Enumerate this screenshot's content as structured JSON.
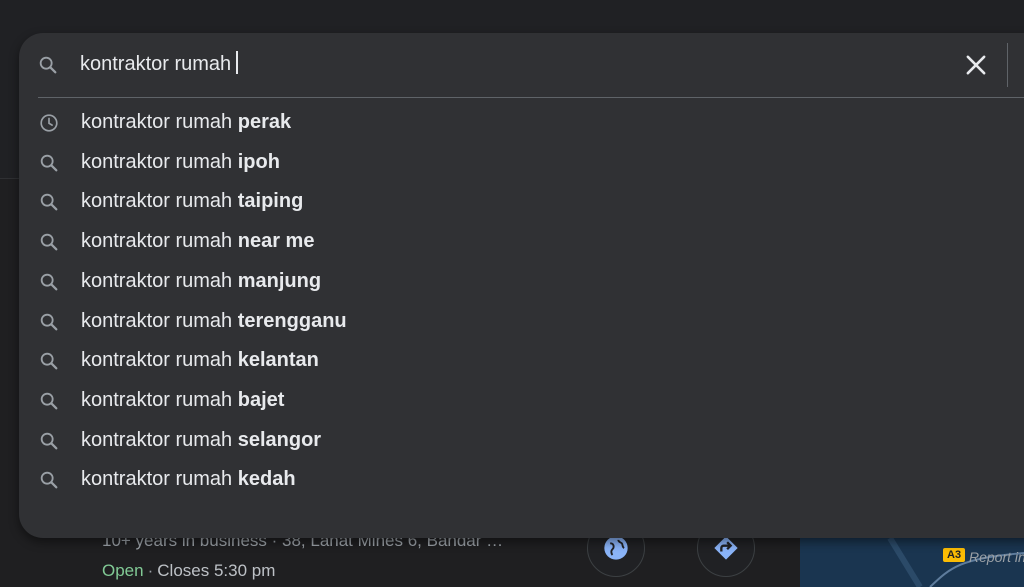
{
  "search": {
    "query": "kontraktor rumah",
    "clear_icon": "close-icon",
    "search_icon": "search-icon"
  },
  "suggestions": [
    {
      "prefix": "kontraktor rumah ",
      "completion": "perak",
      "icon": "history-icon"
    },
    {
      "prefix": "kontraktor rumah ",
      "completion": "ipoh",
      "icon": "search-icon"
    },
    {
      "prefix": "kontraktor rumah ",
      "completion": "taiping",
      "icon": "search-icon"
    },
    {
      "prefix": "kontraktor rumah ",
      "completion": "near me",
      "icon": "search-icon"
    },
    {
      "prefix": "kontraktor rumah ",
      "completion": "manjung",
      "icon": "search-icon"
    },
    {
      "prefix": "kontraktor rumah ",
      "completion": "terengganu",
      "icon": "search-icon"
    },
    {
      "prefix": "kontraktor rumah ",
      "completion": "kelantan",
      "icon": "search-icon"
    },
    {
      "prefix": "kontraktor rumah ",
      "completion": "bajet",
      "icon": "search-icon"
    },
    {
      "prefix": "kontraktor rumah ",
      "completion": "selangor",
      "icon": "search-icon"
    },
    {
      "prefix": "kontraktor rumah ",
      "completion": "kedah",
      "icon": "search-icon"
    }
  ],
  "report_link": "Report inap",
  "background_listing": {
    "details": "10+ years in business · 38, Lahat Mines 6, Bandar …",
    "status_open": "Open",
    "status_sep": "·",
    "closes": "Closes 5:30 pm",
    "map_label": "A3"
  },
  "colors": {
    "dropdown_bg": "#303134",
    "page_bg": "#202124",
    "text": "#e8eaed",
    "open_green": "#81c995"
  }
}
